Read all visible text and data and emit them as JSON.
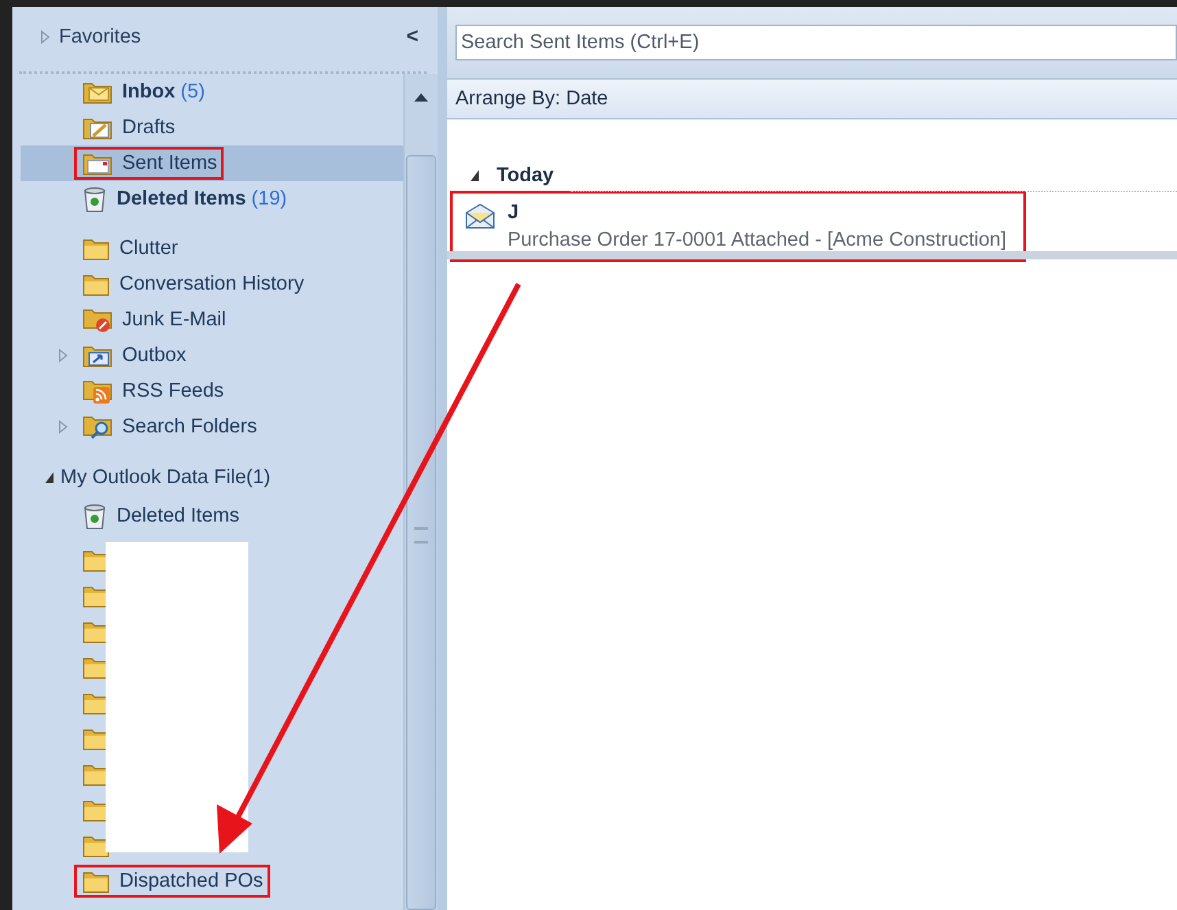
{
  "navigation": {
    "favorites": {
      "label": "Favorites",
      "expanded": false
    },
    "collapse_button": "<",
    "folders": [
      {
        "kind": "inbox",
        "label": "Inbox",
        "count": "(5)",
        "bold": true,
        "selected": false,
        "highlighted": false,
        "expander": false
      },
      {
        "kind": "drafts",
        "label": "Drafts",
        "bold": false,
        "selected": false,
        "highlighted": false,
        "expander": false
      },
      {
        "kind": "sent",
        "label": "Sent Items",
        "bold": false,
        "selected": true,
        "highlighted": true,
        "expander": false
      },
      {
        "kind": "trash",
        "label": "Deleted Items",
        "count": "(19)",
        "bold": true,
        "selected": false,
        "highlighted": false,
        "expander": false
      },
      {
        "kind": "folder",
        "label": "Clutter",
        "bold": false,
        "selected": false,
        "highlighted": false,
        "expander": false
      },
      {
        "kind": "folder",
        "label": "Conversation History",
        "bold": false,
        "selected": false,
        "highlighted": false,
        "expander": false
      },
      {
        "kind": "junk",
        "label": "Junk E-Mail",
        "bold": false,
        "selected": false,
        "highlighted": false,
        "expander": false
      },
      {
        "kind": "outbox",
        "label": "Outbox",
        "bold": false,
        "selected": false,
        "highlighted": false,
        "expander": true
      },
      {
        "kind": "rss",
        "label": "RSS Feeds",
        "bold": false,
        "selected": false,
        "highlighted": false,
        "expander": false
      },
      {
        "kind": "search",
        "label": "Search Folders",
        "bold": false,
        "selected": false,
        "highlighted": false,
        "expander": true
      }
    ],
    "data_file": {
      "label": "My Outlook Data File(1)",
      "expanded": true,
      "folders": [
        {
          "kind": "trash",
          "label": "Deleted Items",
          "highlighted": false
        },
        {
          "kind": "redacted"
        },
        {
          "kind": "redacted"
        },
        {
          "kind": "redacted"
        },
        {
          "kind": "redacted"
        },
        {
          "kind": "redacted"
        },
        {
          "kind": "redacted"
        },
        {
          "kind": "redacted"
        },
        {
          "kind": "redacted"
        },
        {
          "kind": "redacted"
        },
        {
          "kind": "folder",
          "label": "Dispatched POs",
          "highlighted": true
        }
      ]
    }
  },
  "mail_list": {
    "search": {
      "placeholder": "Search Sent Items (Ctrl+E)"
    },
    "arrange_by": "Arrange By: Date",
    "groups": [
      {
        "label": "Today",
        "expanded": true,
        "messages": [
          {
            "sender": "J",
            "subject": "Purchase Order 17-0001 Attached - [Acme Construction]",
            "highlighted": true
          }
        ]
      }
    ]
  },
  "annotation_arrow": true
}
